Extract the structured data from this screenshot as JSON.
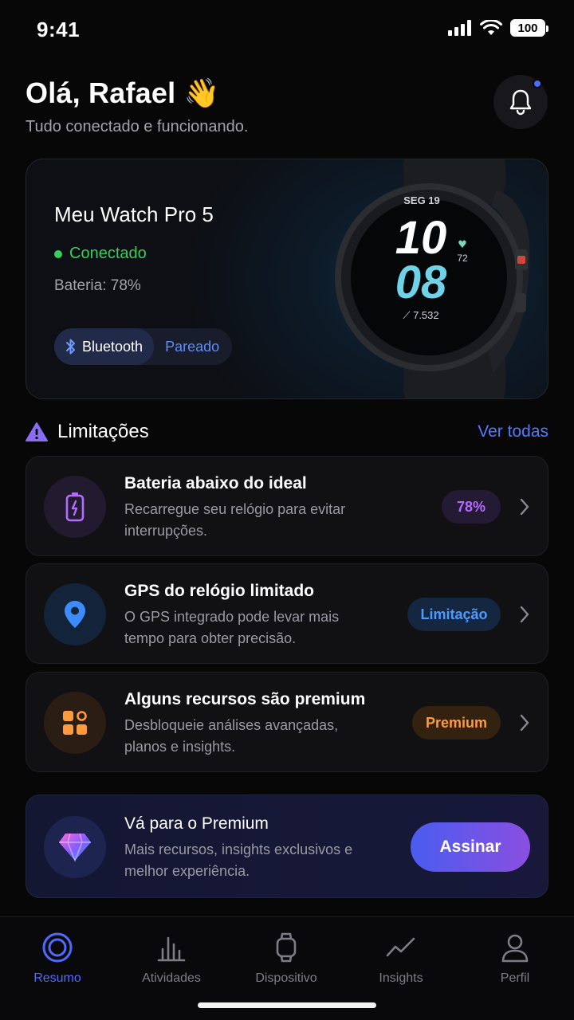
{
  "status_bar": {
    "time": "9:41",
    "battery": "100"
  },
  "header": {
    "greeting": "Olá, Rafael 👋",
    "subtitle": "Tudo conectado e funcionando.",
    "notification_icon": "bell-icon"
  },
  "device": {
    "name": "Meu Watch Pro 5",
    "status": "Conectado",
    "battery": "Bateria: 78%",
    "bluetooth_label": "Bluetooth",
    "paired_label": "Pareado",
    "watch_face": {
      "date": "SEG 19",
      "hour": "10",
      "minute": "08",
      "heart_rate": "72",
      "steps": "7.532"
    }
  },
  "limitations": {
    "title": "Limitações",
    "see_all": "Ver todas",
    "items": [
      {
        "title": "Bateria abaixo do ideal",
        "desc": "Recarregue seu relógio para evitar interrupções.",
        "badge": "78%",
        "icon": "battery-icon"
      },
      {
        "title": "GPS do relógio limitado",
        "desc": "O GPS integrado pode levar mais tempo para obter precisão.",
        "badge": "Limitação",
        "icon": "location-pin-icon"
      },
      {
        "title": "Alguns recursos são premium",
        "desc": "Desbloqueie análises avançadas, planos e insights.",
        "badge": "Premium",
        "icon": "apps-grid-icon"
      }
    ]
  },
  "premium": {
    "title": "Vá para o Premium",
    "desc": "Mais recursos, insights exclusivos e melhor experiência.",
    "button": "Assinar"
  },
  "tabs": [
    {
      "label": "Resumo",
      "active": true
    },
    {
      "label": "Atividades",
      "active": false
    },
    {
      "label": "Dispositivo",
      "active": false
    },
    {
      "label": "Insights",
      "active": false
    },
    {
      "label": "Perfil",
      "active": false
    }
  ],
  "colors": {
    "accent": "#4f6bff",
    "connected": "#34d058",
    "battery_badge": "#b46bff",
    "limit_badge": "#4e9bff",
    "premium_badge": "#ff9a3d"
  }
}
